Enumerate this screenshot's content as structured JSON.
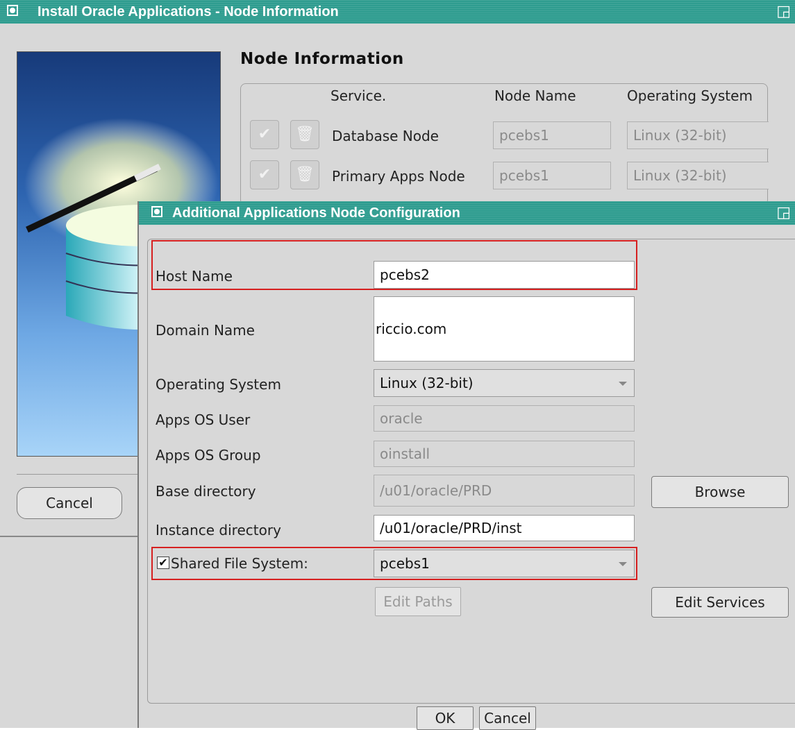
{
  "main_window": {
    "title": "Install Oracle Applications - Node Information",
    "section_title": "Node Information",
    "table": {
      "headers": [
        "Service.",
        "Node Name",
        "Operating System"
      ],
      "rows": [
        {
          "service": "Database Node",
          "node_name": "pcebs1",
          "os": "Linux (32-bit)"
        },
        {
          "service": "Primary Apps Node",
          "node_name": "pcebs1",
          "os": "Linux (32-bit)"
        }
      ]
    },
    "cancel_label": "Cancel"
  },
  "dialog": {
    "title": "Additional Applications Node Configuration",
    "labels": {
      "host_name": "Host Name",
      "domain_name": "Domain Name",
      "operating_system": "Operating System",
      "apps_os_user": "Apps OS User",
      "apps_os_group": "Apps OS Group",
      "base_directory": "Base directory",
      "instance_directory": "Instance directory",
      "shared_file_system": "Shared File System:"
    },
    "values": {
      "host_name": "pcebs2",
      "domain_name": "riccio.com",
      "operating_system": "Linux (32-bit)",
      "apps_os_user": "oracle",
      "apps_os_group": "oinstall",
      "base_directory": "/u01/oracle/PRD",
      "instance_directory": "/u01/oracle/PRD/inst",
      "shared_file_system": "pcebs1"
    },
    "shared_file_system_checked": true,
    "buttons": {
      "browse": "Browse",
      "edit_paths": "Edit Paths",
      "edit_services": "Edit Services",
      "ok": "OK",
      "cancel": "Cancel"
    }
  },
  "colors": {
    "titlebar": "#2e9c8f",
    "highlight": "#d62020",
    "window_bg": "#d8d8d8"
  },
  "icons": [
    "window-menu-icon",
    "maximize-icon",
    "edit-node-icon",
    "delete-node-icon",
    "wizard-image",
    "checkbox-checked-icon",
    "dropdown-arrow-icon"
  ]
}
